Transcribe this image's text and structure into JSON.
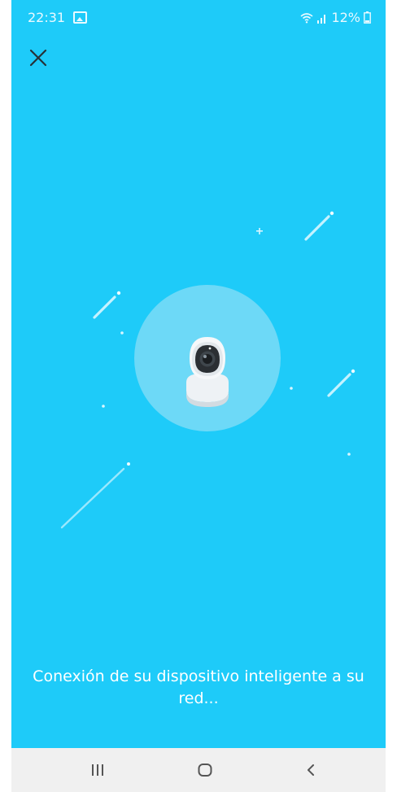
{
  "status_bar": {
    "time": "22:31",
    "battery": "12%",
    "icons": [
      "gallery-icon",
      "wifi-icon",
      "signal-icon",
      "battery-icon"
    ]
  },
  "header": {
    "close_icon": "close-icon"
  },
  "main": {
    "message": "Conexión de su dispositivo inteligente a su red...",
    "illustration_icon": "security-camera-icon"
  },
  "nav_bar": {
    "buttons": [
      "recent-apps-icon",
      "home-icon",
      "back-icon"
    ]
  },
  "colors": {
    "background": "#1ecbf9",
    "circle": "#6dd9f7",
    "nav_bar": "#f0f0f0",
    "nav_icon": "#555555"
  }
}
